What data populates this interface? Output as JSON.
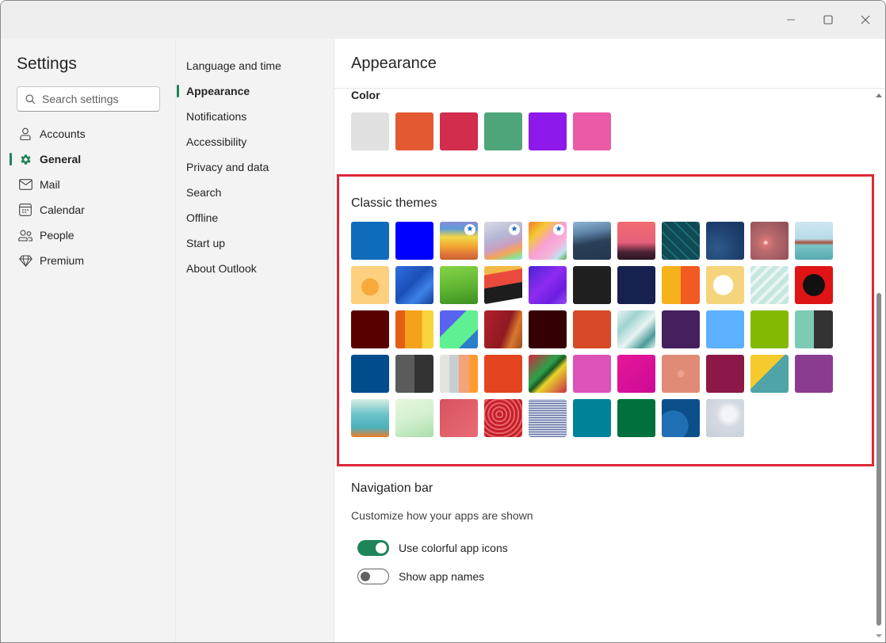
{
  "window": {
    "controls": {
      "minimize": "minimize",
      "maximize": "maximize",
      "close": "close"
    }
  },
  "sidebar": {
    "title": "Settings",
    "search": {
      "placeholder": "Search settings",
      "value": ""
    },
    "items": [
      {
        "label": "Accounts",
        "icon": "person-icon",
        "active": false
      },
      {
        "label": "General",
        "icon": "gear-icon",
        "active": true
      },
      {
        "label": "Mail",
        "icon": "mail-icon",
        "active": false
      },
      {
        "label": "Calendar",
        "icon": "calendar-icon",
        "active": false
      },
      {
        "label": "People",
        "icon": "people-icon",
        "active": false
      },
      {
        "label": "Premium",
        "icon": "diamond-icon",
        "active": false
      }
    ]
  },
  "subnav": {
    "items": [
      {
        "label": "Language and time",
        "active": false
      },
      {
        "label": "Appearance",
        "active": true
      },
      {
        "label": "Notifications",
        "active": false
      },
      {
        "label": "Accessibility",
        "active": false
      },
      {
        "label": "Privacy and data",
        "active": false
      },
      {
        "label": "Search",
        "active": false
      },
      {
        "label": "Offline",
        "active": false
      },
      {
        "label": "Start up",
        "active": false
      },
      {
        "label": "About Outlook",
        "active": false
      }
    ]
  },
  "main": {
    "title": "Appearance",
    "color": {
      "label": "Color",
      "swatches": [
        "#e0e0e0",
        "#e35a32",
        "#d22d4c",
        "#4fa57a",
        "#8d1aeb",
        "#ea5aa6"
      ]
    },
    "classic_themes": {
      "label": "Classic themes",
      "accent_highlight": "#dc2836",
      "themes": [
        {
          "name": "blue",
          "bg": "#0f6cbd",
          "premium": false
        },
        {
          "name": "bright-blue",
          "bg": "#0000ff",
          "premium": false
        },
        {
          "name": "rainbow-waves",
          "bg": "linear-gradient(180deg,#8d8cd6 0%,#5a9bd8 18%,#f1d84a 40%,#f2a62f 65%,#e0763a 85%,#c8622e 100%)",
          "premium": true
        },
        {
          "name": "silver-ribbons",
          "bg": "linear-gradient(160deg,#d9d9e6 0%,#b5b5d5 40%,#c8a0c0 60%,#f7a35a 75%,#8fe08f 90%,#a8d8f0 100%)",
          "premium": true
        },
        {
          "name": "unicorn",
          "bg": "linear-gradient(135deg,#f27a2a 0%,#f4c830 25%,#f7a0d5 50%,#f5b2da 70%,#bfe3f3 85%,#5aa33a 100%)",
          "premium": true
        },
        {
          "name": "ocean-wave",
          "bg": "linear-gradient(170deg,#8cb6d6 0%,#5d82a6 30%,#2b3f57 55%,#23374e 100%)",
          "premium": false
        },
        {
          "name": "palm-sunset",
          "bg": "linear-gradient(180deg,#f26b70 0%,#e5607a 55%,#4a2233 80%,#2c1520 100%)",
          "premium": false
        },
        {
          "name": "circuit",
          "bg": "repeating-linear-gradient(45deg,#0f4a55 0 4px,#1c6d74 4px 6px,#0f4a55 6px 10px)",
          "premium": false
        },
        {
          "name": "elevation",
          "bg": "radial-gradient(circle at 30% 70%,#2e5a8c 0%,#1d3f6e 60%,#17345c 100%)",
          "premium": false
        },
        {
          "name": "lights",
          "bg": "radial-gradient(circle at 40% 55%,#ffd0d0 0 4%,#d77 8%,#b86a6d 30%,#8c4d54 100%)",
          "premium": false
        },
        {
          "name": "boat-waves",
          "bg": "linear-gradient(180deg,#cfe6f3 0%,#b6dbe8 45%,#a64b3b 55%,#7cc6c8 62%,#56a9ae 100%)",
          "premium": false
        },
        {
          "name": "star",
          "bg": "radial-gradient(circle at 50% 55%,#f8a93a 0 30%,#fcd07f 31% 100%)",
          "premium": false
        },
        {
          "name": "blue-swirl",
          "bg": "linear-gradient(135deg,#2e6fe0 0%,#1b4fb8 45%,#3d82e8 70%,#153f96 100%)",
          "premium": false
        },
        {
          "name": "green-bubbles",
          "bg": "linear-gradient(170deg,#86d446 0%,#5fb532 55%,#3c8f22 100%)",
          "premium": false
        },
        {
          "name": "red-fold",
          "bg": "linear-gradient(170deg,#f3b946 0%,#f3b946 20%,#e94a3b 21%,#e94a3b 50%,#1d1d1d 51%,#1d1d1d 85%,#ffffff 86%)",
          "premium": false
        },
        {
          "name": "purple-abstract",
          "bg": "linear-gradient(135deg,#4a23d5 0%,#8e2cf0 45%,#6b1ee0 75%,#9a4cf5 100%)",
          "premium": false
        },
        {
          "name": "charcoal",
          "bg": "#1f1f1f",
          "premium": false
        },
        {
          "name": "navy",
          "bg": "#16214f",
          "premium": false
        },
        {
          "name": "building-blocks",
          "bg": "linear-gradient(90deg,#f6b21a 0 50%,#f15a22 50% 100%)",
          "premium": false
        },
        {
          "name": "lucky-cat",
          "bg": "radial-gradient(circle at 45% 50%,#ffffff 0 35%,#f5d47c 36% 100%)",
          "premium": false
        },
        {
          "name": "mint-chevron",
          "bg": "repeating-linear-gradient(135deg,#c6e6e1 0 6px,#e8f5f3 6px 10px)",
          "premium": false
        },
        {
          "name": "red-dots",
          "bg": "radial-gradient(circle,#111 0 40%,#e01414 42%)",
          "premium": false
        },
        {
          "name": "maroon",
          "bg": "#580000",
          "premium": false
        },
        {
          "name": "crayons",
          "bg": "linear-gradient(90deg,#e35e12 0 25%,#f4a21b 25% 70%,#f6d43a 70% 100%)",
          "premium": false
        },
        {
          "name": "tetris-blocks",
          "bg": "linear-gradient(135deg,#5a63ef 0 35%,#5ff092 35% 75%,#2d7ec9 75% 100%)",
          "premium": false
        },
        {
          "name": "feather",
          "bg": "linear-gradient(110deg,#b3202c 0%,#8e1923 55%,#d8782e 75%,#9b4d1f 100%)",
          "premium": false
        },
        {
          "name": "dark-maroon",
          "bg": "#350003",
          "premium": false
        },
        {
          "name": "orange-red",
          "bg": "#d74927",
          "premium": false
        },
        {
          "name": "hexagons",
          "bg": "linear-gradient(135deg,#e7f3f2 0%,#9fd3cf 30%,#e9f4f3 55%,#4a9a9a 80%,#eaf5f3 100%)",
          "premium": false
        },
        {
          "name": "deep-purple",
          "bg": "#45205e",
          "premium": false
        },
        {
          "name": "sky-blue",
          "bg": "#5cb0fd",
          "premium": false
        },
        {
          "name": "lime",
          "bg": "#84b901",
          "premium": false
        },
        {
          "name": "mint-charcoal",
          "bg": "linear-gradient(90deg,#7dcab7 0 50%,#333333 50% 100%)",
          "premium": false
        },
        {
          "name": "cobalt",
          "bg": "#004c8c",
          "premium": false
        },
        {
          "name": "gray-split",
          "bg": "linear-gradient(90deg,#5b5b5b 0 50%,#333333 50% 100%)",
          "premium": false
        },
        {
          "name": "pastel-stripes",
          "bg": "linear-gradient(90deg,#e3e3e0 0 25%,#c7ced2 25% 50%,#f4a277 50% 78%,#ff9a2c 78% 100%)",
          "premium": false
        },
        {
          "name": "vermilion",
          "bg": "#e3461f",
          "premium": false
        },
        {
          "name": "psychedelic",
          "bg": "linear-gradient(135deg,#d5253d 0%,#2ba34a 40%,#1e5a22 50%,#e8d42b 60%,#c82d45 100%)",
          "premium": false
        },
        {
          "name": "orchid",
          "bg": "#dc52b7",
          "premium": false
        },
        {
          "name": "magenta",
          "bg": "linear-gradient(135deg,#e81798 0%,#cb0a97 100%)",
          "premium": false
        },
        {
          "name": "salmon-polka",
          "bg": "radial-gradient(circle at 50% 50%,#f0a08e 0 12%,#e08b76 14%)",
          "premium": false
        },
        {
          "name": "burgundy",
          "bg": "#8c1847",
          "premium": false
        },
        {
          "name": "material",
          "bg": "linear-gradient(135deg,#f6c92d 0 45%,#4fa4a7 45% 100%)",
          "premium": false
        },
        {
          "name": "violet",
          "bg": "#8a3c91",
          "premium": false
        },
        {
          "name": "robot",
          "bg": "linear-gradient(180deg,#d6eee4 0%,#6cc3c9 40%,#4bb0ba 75%,#f07c29 100%)",
          "premium": false
        },
        {
          "name": "pale-green-facets",
          "bg": "linear-gradient(160deg,#e6f7dc 0%,#d3f0cf 50%,#a9deaa 100%)",
          "premium": false
        },
        {
          "name": "coral-facets",
          "bg": "linear-gradient(135deg,#d5535f 0%,#e1616b 55%,#e86a74 100%)",
          "premium": false
        },
        {
          "name": "strawberry",
          "bg": "repeating-radial-gradient(circle at 40% 40%,#c52029 0 3px,#e8656a 3px 5px)",
          "premium": false
        },
        {
          "name": "denim-heart",
          "bg": "repeating-linear-gradient(0deg,#5d6c9e 0 1px,#c9cfe2 1px 3px)",
          "premium": false
        },
        {
          "name": "teal",
          "bg": "#008299",
          "premium": false
        },
        {
          "name": "forest",
          "bg": "#01703c",
          "premium": false
        },
        {
          "name": "blue-circles",
          "bg": "radial-gradient(circle at 30% 70%,#1e6fb3 0 40%,#0b4f8a 41% 100%)",
          "premium": false
        },
        {
          "name": "snowflakes",
          "bg": "radial-gradient(circle at 60% 40%,#f2f4f7 0 20%,#d5dae2 40%,#c7ced8 100%)",
          "premium": false
        }
      ]
    },
    "navigation_bar": {
      "title": "Navigation bar",
      "description": "Customize how your apps are shown",
      "toggles": [
        {
          "label": "Use colorful app icons",
          "on": true
        },
        {
          "label": "Show app names",
          "on": false
        }
      ]
    }
  }
}
